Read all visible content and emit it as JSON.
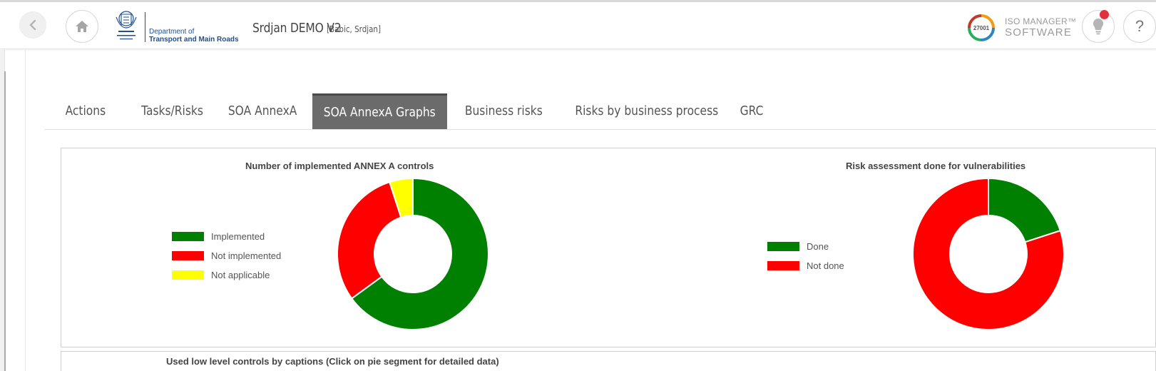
{
  "header": {
    "dept_line1": "Department of",
    "dept_line2": "Transport and Main Roads",
    "app_title": "Srdjan DEMO V2",
    "app_user": "[Babic, Srdjan]",
    "iso_badge": "27001",
    "iso_brand1": "ISO MANAGER™",
    "iso_brand2": "SOFTWARE",
    "help_label": "?",
    "icons": [
      "chevron-left-icon",
      "home-icon",
      "queensland-crest-icon",
      "iso-ring-icon",
      "lightbulb-icon",
      "question-icon"
    ]
  },
  "tabs": [
    {
      "label": "Actions",
      "active": false
    },
    {
      "label": "Tasks/Risks",
      "active": false
    },
    {
      "label": "SOA AnnexA",
      "active": false
    },
    {
      "label": "SOA AnnexA Graphs",
      "active": true
    },
    {
      "label": "Business risks",
      "active": false
    },
    {
      "label": "Risks by business process",
      "active": false
    },
    {
      "label": "GRC",
      "active": false
    }
  ],
  "colors": {
    "green": "#008000",
    "red": "#ff0000",
    "yellow": "#ffff00",
    "active_tab": "#6b6b6b",
    "brand_blue": "#1d4f91"
  },
  "chart_data": [
    {
      "type": "pie",
      "title": "Number of implemented ANNEX A controls",
      "categories": [
        "Implemented",
        "Not implemented",
        "Not applicable"
      ],
      "values": [
        65,
        30,
        5
      ],
      "colors": [
        "#008000",
        "#ff0000",
        "#ffff00"
      ],
      "legend": "left"
    },
    {
      "type": "pie",
      "title": "Risk assessment done for vulnerabilities",
      "categories": [
        "Done",
        "Not done"
      ],
      "values": [
        20,
        80
      ],
      "colors": [
        "#008000",
        "#ff0000"
      ],
      "legend": "left"
    },
    {
      "type": "pie",
      "title": "Used low level controls by captions (Click on pie segment for detailed data)"
    }
  ]
}
